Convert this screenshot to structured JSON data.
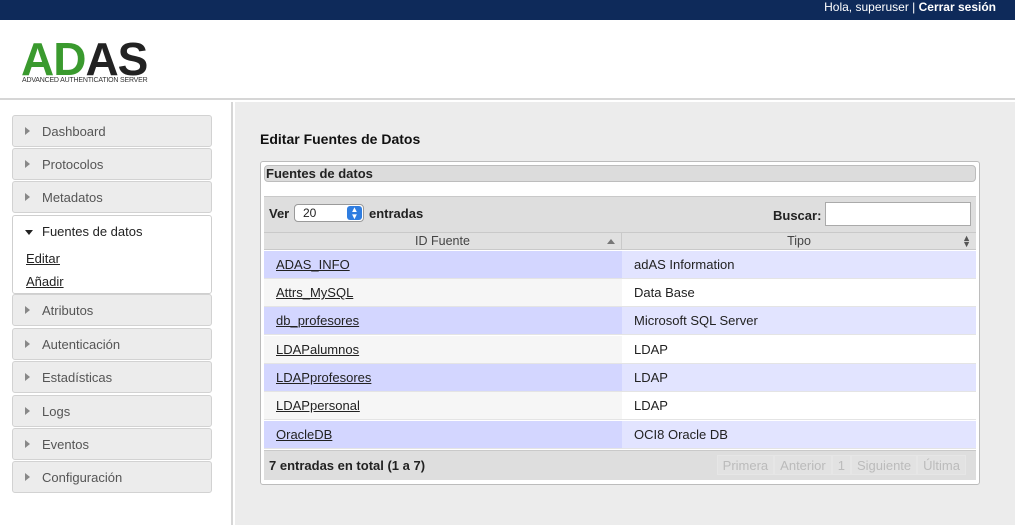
{
  "topbar": {
    "greeting": "Hola, superuser | ",
    "logout": "Cerrar sesión"
  },
  "logo": {
    "part_green": "AD",
    "part_dark": "AS",
    "subtitle": "ADVANCED AUTHENTICATION SERVER"
  },
  "sidebar": {
    "items": [
      {
        "label": "Dashboard"
      },
      {
        "label": "Protocolos"
      },
      {
        "label": "Metadatos"
      },
      {
        "label": "Fuentes de datos"
      },
      {
        "label": "Atributos"
      },
      {
        "label": "Autenticación"
      },
      {
        "label": "Estadísticas"
      },
      {
        "label": "Logs"
      },
      {
        "label": "Eventos"
      },
      {
        "label": "Configuración"
      }
    ],
    "submenu": {
      "edit": "Editar",
      "add": "Añadir"
    }
  },
  "main": {
    "title": "Editar Fuentes de Datos",
    "panel_title": "Fuentes de datos",
    "length_label": "Ver",
    "length_value": "20",
    "length_suffix": "entradas",
    "search_label": "Buscar:",
    "search_value": "",
    "columns": [
      "ID Fuente",
      "Tipo"
    ],
    "rows": [
      {
        "id": "ADAS_INFO",
        "type": "adAS Information"
      },
      {
        "id": "Attrs_MySQL",
        "type": "Data Base"
      },
      {
        "id": "db_profesores",
        "type": "Microsoft SQL Server"
      },
      {
        "id": "LDAPalumnos",
        "type": "LDAP"
      },
      {
        "id": "LDAPprofesores",
        "type": "LDAP"
      },
      {
        "id": "LDAPpersonal",
        "type": "LDAP"
      },
      {
        "id": "OracleDB",
        "type": "OCI8 Oracle DB"
      }
    ],
    "info": "7 entradas en total (1 a 7)",
    "pager": {
      "first": "Primera",
      "prev": "Anterior",
      "page": "1",
      "next": "Siguiente",
      "last": "Última"
    }
  },
  "colors": {
    "topbar": "#0e2a5a",
    "logo_green": "#3a9a2e",
    "row_highlight": "#d3d6ff"
  }
}
